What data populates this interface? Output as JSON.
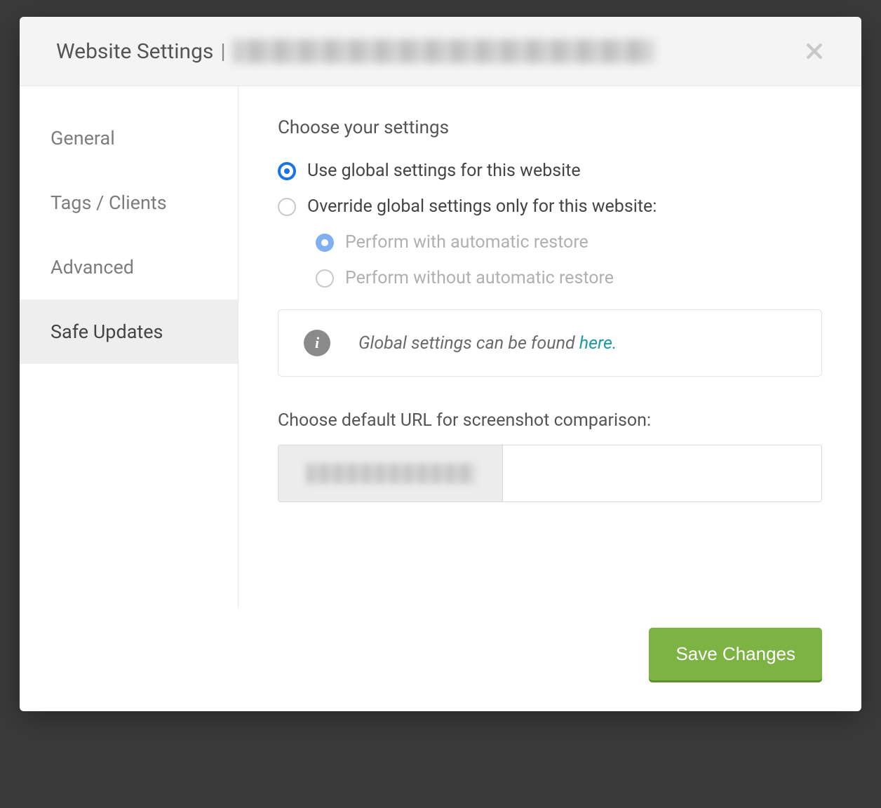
{
  "modal": {
    "title": "Website Settings",
    "separator": "|",
    "close_label": "Close"
  },
  "sidebar": {
    "items": [
      {
        "label": "General",
        "active": false
      },
      {
        "label": "Tags / Clients",
        "active": false
      },
      {
        "label": "Advanced",
        "active": false
      },
      {
        "label": "Safe Updates",
        "active": true
      }
    ]
  },
  "content": {
    "heading": "Choose your settings",
    "radios": {
      "use_global": "Use global settings for this website",
      "override": "Override global settings only for this website:",
      "perform_with": "Perform with automatic restore",
      "perform_without": "Perform without automatic restore"
    },
    "info": {
      "text_prefix": "Global settings can be found ",
      "link_text": "here."
    },
    "url_section": {
      "label": "Choose default URL for screenshot comparison:",
      "input_value": ""
    }
  },
  "footer": {
    "save_label": "Save Changes"
  }
}
